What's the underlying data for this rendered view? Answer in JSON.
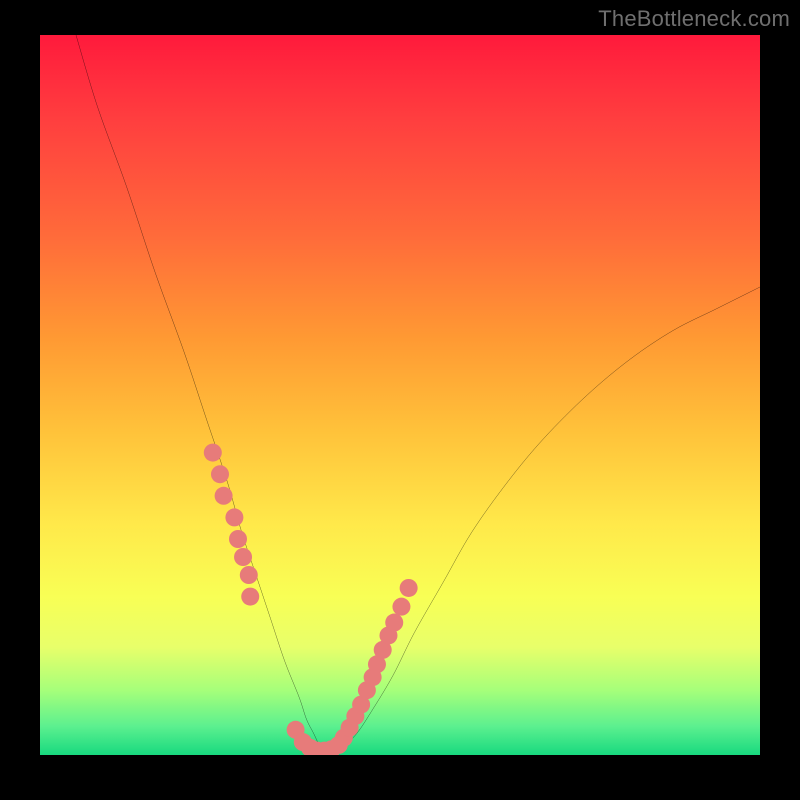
{
  "watermark": "TheBottleneck.com",
  "colors": {
    "frame": "#000000",
    "curve_stroke": "#000000",
    "dot_fill": "#e77b7a",
    "gradient_stops": [
      "#ff1a3c",
      "#ff3f3f",
      "#ff6b3a",
      "#ff9933",
      "#ffc23a",
      "#ffe94a",
      "#f8ff55",
      "#e8ff6a",
      "#a6ff7a",
      "#5cf08f",
      "#18d97f"
    ]
  },
  "chart_data": {
    "type": "line",
    "title": "",
    "xlabel": "",
    "ylabel": "",
    "xlim": [
      0,
      100
    ],
    "ylim": [
      0,
      100
    ],
    "note": "No axis ticks or numeric labels are visible. x/y below are normalised 0–100 across the plotting area; y is bottleneck-percentage-like (0 = bottom/green, 100 = top/red). Values estimated from pixel positions.",
    "series": [
      {
        "name": "bottleneck-curve",
        "x": [
          5,
          8,
          12,
          16,
          20,
          23,
          26,
          28,
          30,
          32,
          34,
          36,
          37,
          38,
          39,
          40,
          42,
          44,
          46,
          49,
          52,
          56,
          60,
          65,
          70,
          76,
          82,
          88,
          94,
          100
        ],
        "y": [
          100,
          90,
          79,
          67,
          56,
          47,
          38,
          31,
          25,
          19,
          13,
          8,
          5,
          3,
          1,
          0,
          1,
          3,
          6,
          11,
          17,
          24,
          31,
          38,
          44,
          50,
          55,
          59,
          62,
          65
        ]
      }
    ],
    "highlight_points": {
      "name": "salmon-dots",
      "note": "Cluster markers overlaid on the curve near the valley and its flanks. Coordinates in same 0–100 space.",
      "points": [
        {
          "x": 24.0,
          "y": 42.0
        },
        {
          "x": 25.0,
          "y": 39.0
        },
        {
          "x": 25.5,
          "y": 36.0
        },
        {
          "x": 27.0,
          "y": 33.0
        },
        {
          "x": 27.5,
          "y": 30.0
        },
        {
          "x": 28.2,
          "y": 27.5
        },
        {
          "x": 29.0,
          "y": 25.0
        },
        {
          "x": 29.2,
          "y": 22.0
        },
        {
          "x": 35.5,
          "y": 3.5
        },
        {
          "x": 36.5,
          "y": 1.8
        },
        {
          "x": 37.5,
          "y": 1.0
        },
        {
          "x": 38.5,
          "y": 0.6
        },
        {
          "x": 39.5,
          "y": 0.6
        },
        {
          "x": 40.5,
          "y": 0.8
        },
        {
          "x": 41.5,
          "y": 1.4
        },
        {
          "x": 42.2,
          "y": 2.4
        },
        {
          "x": 43.0,
          "y": 3.8
        },
        {
          "x": 43.8,
          "y": 5.4
        },
        {
          "x": 44.6,
          "y": 7.0
        },
        {
          "x": 45.4,
          "y": 9.0
        },
        {
          "x": 46.2,
          "y": 10.8
        },
        {
          "x": 46.8,
          "y": 12.6
        },
        {
          "x": 47.6,
          "y": 14.6
        },
        {
          "x": 48.4,
          "y": 16.6
        },
        {
          "x": 49.2,
          "y": 18.4
        },
        {
          "x": 50.2,
          "y": 20.6
        },
        {
          "x": 51.2,
          "y": 23.2
        }
      ]
    },
    "minimum": {
      "x": 39,
      "y": 0
    }
  }
}
